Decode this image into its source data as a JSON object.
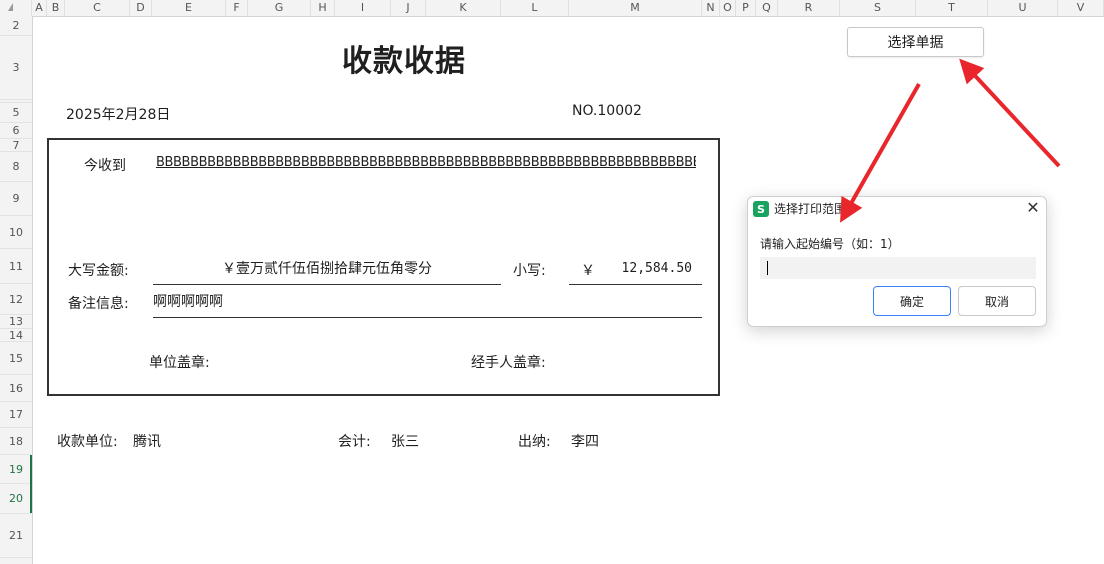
{
  "spreadsheet": {
    "columns": [
      "A",
      "B",
      "C",
      "D",
      "E",
      "F",
      "G",
      "H",
      "I",
      "J",
      "K",
      "L",
      "M",
      "N",
      "O",
      "P",
      "Q",
      "R",
      "S",
      "T",
      "U",
      "V"
    ],
    "rows": [
      "2",
      "3",
      "4",
      "5",
      "6",
      "7",
      "8",
      "9",
      "10",
      "11",
      "12",
      "13",
      "14",
      "15",
      "16",
      "17",
      "18",
      "19",
      "20",
      "21"
    ],
    "selected_rows": [
      "19",
      "20"
    ]
  },
  "receipt": {
    "title": "收款收据",
    "date": "2025年2月28日",
    "number": "NO.10002",
    "received_from_label": "今收到",
    "received_from_value": "BBBBBBBBBBBBBBBBBBBBBBBBBBBBBBBBBBBBBBBBBBBBBBBBBBBBBBBBBBBBBBBBB",
    "amount_upper_label": "大写金额:",
    "amount_upper_value": "￥壹万贰仟伍佰捌拾肆元伍角零分",
    "amount_lower_label": "小写:",
    "amount_lower_currency": "￥",
    "amount_lower_value": "12,584.50",
    "remark_label": "备注信息:",
    "remark_value": "啊啊啊啊啊",
    "unit_seal_label": "单位盖章:",
    "handler_seal_label": "经手人盖章:",
    "payee_unit_label": "收款单位:",
    "payee_unit_value": "腾讯",
    "accountant_label": "会计:",
    "accountant_value": "张三",
    "cashier_label": "出纳:",
    "cashier_value": "李四"
  },
  "toolbar": {
    "select_button_label": "选择单据"
  },
  "dialog": {
    "icon_letter": "S",
    "title": "选择打印范围",
    "prompt": "请输入起始编号（如：1）",
    "input_value": "",
    "ok_label": "确定",
    "cancel_label": "取消",
    "close_glyph": "✕"
  },
  "colors": {
    "arrow": "#e8262b",
    "selected_row": "#217346",
    "dialog_icon": "#1aa260",
    "ok_border": "#3b82f6"
  }
}
